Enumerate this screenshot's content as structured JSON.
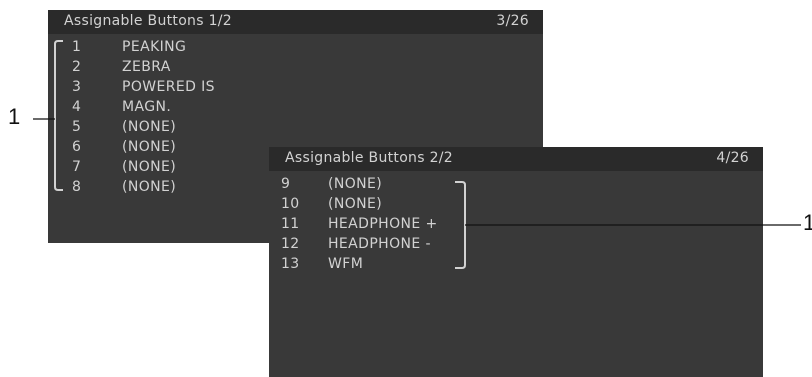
{
  "colors": {
    "screen_bg": "#393939",
    "header_bg": "#2a2a2a",
    "text": "#d2d2d2",
    "callout": "#111111"
  },
  "screen1": {
    "title": "Assignable Buttons 1/2",
    "page": "3/26",
    "items": [
      {
        "num": "1",
        "label": "PEAKING"
      },
      {
        "num": "2",
        "label": "ZEBRA"
      },
      {
        "num": "3",
        "label": "POWERED IS"
      },
      {
        "num": "4",
        "label": "MAGN."
      },
      {
        "num": "5",
        "label": "(NONE)"
      },
      {
        "num": "6",
        "label": "(NONE)"
      },
      {
        "num": "7",
        "label": "(NONE)"
      },
      {
        "num": "8",
        "label": "(NONE)"
      }
    ]
  },
  "screen2": {
    "title": "Assignable Buttons 2/2",
    "page": "4/26",
    "items": [
      {
        "num": "9",
        "label": "(NONE)"
      },
      {
        "num": "10",
        "label": "(NONE)"
      },
      {
        "num": "11",
        "label": "HEADPHONE +"
      },
      {
        "num": "12",
        "label": "HEADPHONE -"
      },
      {
        "num": "13",
        "label": "WFM"
      }
    ]
  },
  "callouts": {
    "left": "1",
    "right": "1"
  }
}
